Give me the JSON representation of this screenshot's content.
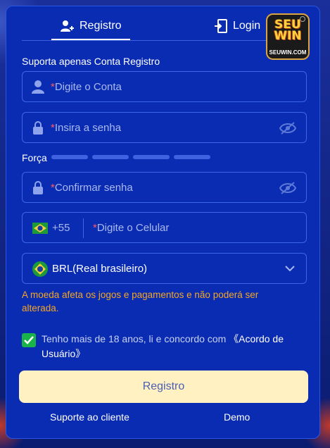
{
  "tabs": {
    "register": "Registro",
    "login": "Login"
  },
  "logo": {
    "top": "SEU WIN",
    "bottom": "SEUWIN.COM"
  },
  "section_label": "Suporta apenas Conta Registro",
  "fields": {
    "account": {
      "required": "*",
      "placeholder": "Digite o Conta"
    },
    "password": {
      "required": "*",
      "placeholder": "Insira a senha"
    },
    "confirm": {
      "required": "*",
      "placeholder": "Confirmar senha"
    },
    "phone": {
      "prefix": "+55",
      "required": "*",
      "placeholder": "Digite o Celular"
    }
  },
  "strength_label": "Força",
  "strength_bars_filled": 0,
  "currency": {
    "value": "BRL(Real brasileiro)"
  },
  "warning": "A moeda afeta os jogos e pagamentos e não poderá ser alterada.",
  "agreement": {
    "text": "Tenho mais de 18 anos, li e concordo com ",
    "link": "《Acordo de Usuário》",
    "checked": true
  },
  "submit_label": "Registro",
  "footer": {
    "support": "Suporte ao cliente",
    "demo": "Demo"
  },
  "colors": {
    "panel": "#0a2cb3",
    "accent_button": "#fff1c2",
    "warning": "#f5a623",
    "checkbox": "#19b34a"
  }
}
